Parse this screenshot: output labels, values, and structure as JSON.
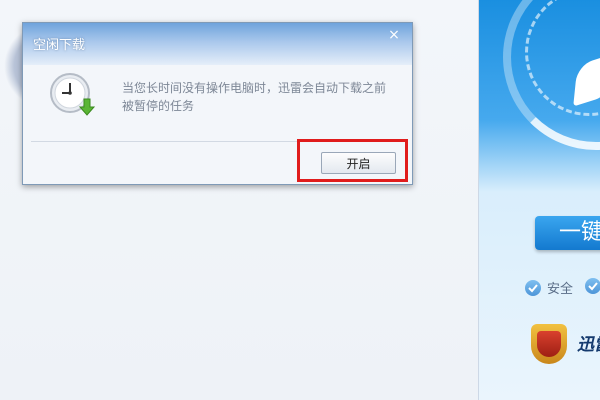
{
  "dialog": {
    "title": "空闲下载",
    "close_glyph": "×",
    "message": "当您长时间没有操作电脑时，迅雷会自动下载之前被暂停的任务",
    "open_button": "开启",
    "icon": "clock-download-icon"
  },
  "right_panel": {
    "one_click_label": "一键",
    "safe_label": "安全",
    "brand_text": "迅雷",
    "check_icon": "check-icon",
    "badge_icon": "shield-badge-icon"
  },
  "colors": {
    "title_gradient_top": "#6fa3dc",
    "highlight": "#e01c1c",
    "accent_blue": "#1a8fe0"
  }
}
